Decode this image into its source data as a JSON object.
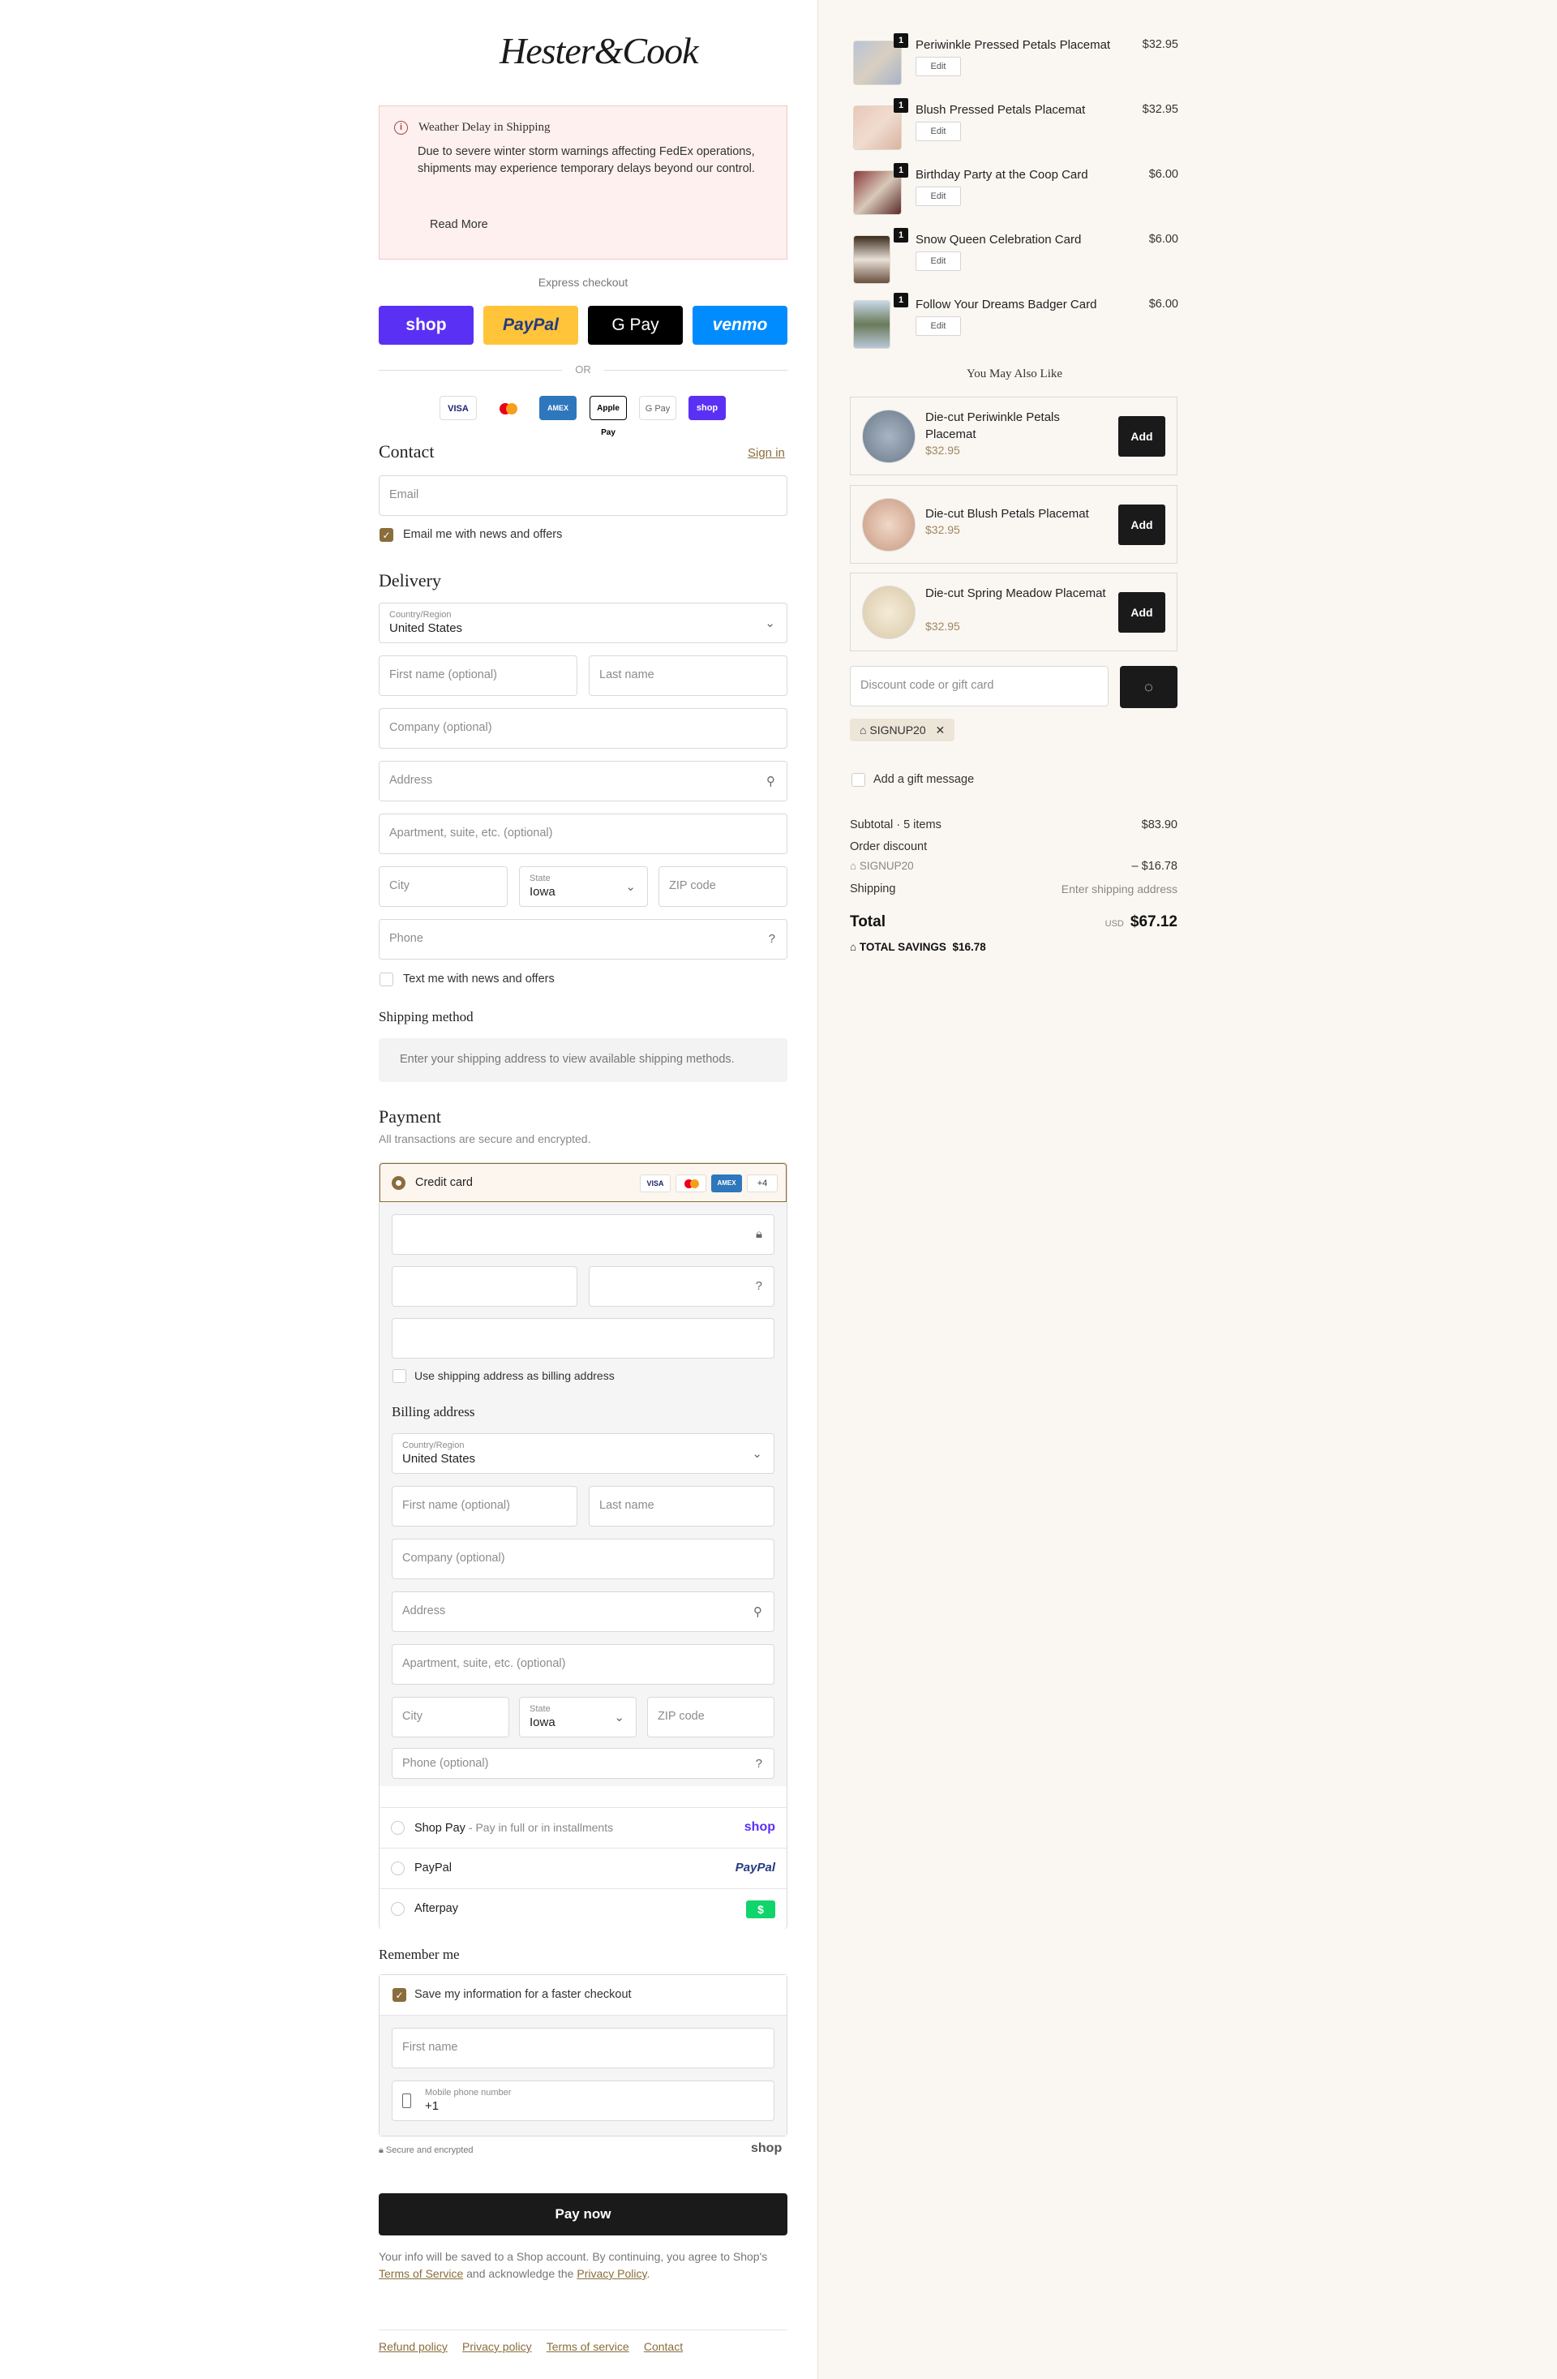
{
  "brand": {
    "logo_text": "Hester&Cook"
  },
  "notice": {
    "title": "Weather Delay in Shipping",
    "body": "Due to severe winter storm warnings affecting FedEx operations, shipments may experience temporary delays beyond our control.",
    "link": "Read More"
  },
  "express": {
    "label": "Express checkout",
    "buttons": [
      {
        "label": "shop",
        "color": "#5a31f4"
      },
      {
        "label": "PayPal",
        "color": "#ffc43a"
      },
      {
        "label": "G Pay",
        "color": "#000000"
      },
      {
        "label": "venmo",
        "color": "#008cff"
      }
    ],
    "or": "OR"
  },
  "card_logos": [
    "VISA",
    "MC",
    "AMEX",
    "Apple Pay",
    "G Pay",
    "shop"
  ],
  "contact": {
    "title": "Contact",
    "sign_in": "Sign in",
    "email_placeholder": "Email",
    "news_label": "Email me with news and offers"
  },
  "delivery": {
    "title": "Delivery",
    "country_label": "Country/Region",
    "country_value": "United States",
    "first_name": "First name (optional)",
    "last_name": "Last name",
    "company": "Company (optional)",
    "address": "Address",
    "apartment": "Apartment, suite, etc. (optional)",
    "city": "City",
    "state_label": "State",
    "state_value": "Iowa",
    "zip": "ZIP code",
    "phone": "Phone",
    "text_label": "Text me with news and offers"
  },
  "shipping": {
    "title": "Shipping method",
    "message": "Enter your shipping address to view available shipping methods."
  },
  "payment": {
    "title": "Payment",
    "subtitle": "All transactions are secure and encrypted.",
    "credit_card": "Credit card",
    "more_cards": "+4",
    "use_shipping": "Use shipping address as billing address",
    "billing_title": "Billing address",
    "billing": {
      "country_label": "Country/Region",
      "country_value": "United States",
      "first_name": "First name (optional)",
      "last_name": "Last name",
      "company": "Company (optional)",
      "address": "Address",
      "apartment": "Apartment, suite, etc. (optional)",
      "city": "City",
      "state_label": "State",
      "state_value": "Iowa",
      "zip": "ZIP code",
      "phone": "Phone (optional)"
    },
    "shop_pay": "Shop Pay",
    "shop_pay_sub": "- Pay in full or in installments",
    "shop_logo": "shop",
    "paypal": "PayPal",
    "paypal_logo": "PayPal",
    "afterpay": "Afterpay",
    "afterpay_logo": "$"
  },
  "remember": {
    "title": "Remember me",
    "save_label": "Save my information for a faster checkout",
    "first_name": "First name",
    "mobile_label": "Mobile phone number",
    "mobile_value": "+1",
    "secure": "Secure and encrypted",
    "shop": "shop"
  },
  "pay_now": "Pay now",
  "fine_print": {
    "pre": "Your info will be saved to a Shop account. By continuing, you agree to Shop's ",
    "tos": "Terms of Service",
    "mid": " and acknowledge the ",
    "privacy": "Privacy Policy",
    "post": "."
  },
  "footer": [
    "Refund policy",
    "Privacy policy",
    "Terms of service",
    "Contact"
  ],
  "cart": {
    "items": [
      {
        "name": "Periwinkle Pressed Petals Placemat",
        "price": "$32.95",
        "qty": "1",
        "edit": "Edit"
      },
      {
        "name": "Blush Pressed Petals Placemat",
        "price": "$32.95",
        "qty": "1",
        "edit": "Edit"
      },
      {
        "name": "Birthday Party at the Coop Card",
        "price": "$6.00",
        "qty": "1",
        "edit": "Edit"
      },
      {
        "name": "Snow Queen Celebration Card",
        "price": "$6.00",
        "qty": "1",
        "edit": "Edit"
      },
      {
        "name": "Follow Your Dreams Badger Card",
        "price": "$6.00",
        "qty": "1",
        "edit": "Edit"
      }
    ],
    "also_like": "You May Also Like",
    "recommendations": [
      {
        "name": "Die-cut Periwinkle Petals Placemat",
        "price": "$32.95",
        "add": "Add"
      },
      {
        "name": "Die-cut Blush Petals Placemat",
        "price": "$32.95",
        "add": "Add"
      },
      {
        "name": "Die-cut Spring Meadow Placemat",
        "price": "$32.95",
        "add": "Add"
      }
    ],
    "discount_placeholder": "Discount code or gift card",
    "applied_code": "SIGNUP20",
    "gift_message": "Add a gift message",
    "subtotal_label": "Subtotal · 5 items",
    "subtotal": "$83.90",
    "order_discount": "Order discount",
    "discount_code": "SIGNUP20",
    "discount_amount": "– $16.78",
    "shipping_label": "Shipping",
    "shipping_value": "Enter shipping address",
    "total_label": "Total",
    "currency": "USD",
    "total": "$67.12",
    "savings_label": "TOTAL SAVINGS",
    "savings": "$16.78"
  }
}
